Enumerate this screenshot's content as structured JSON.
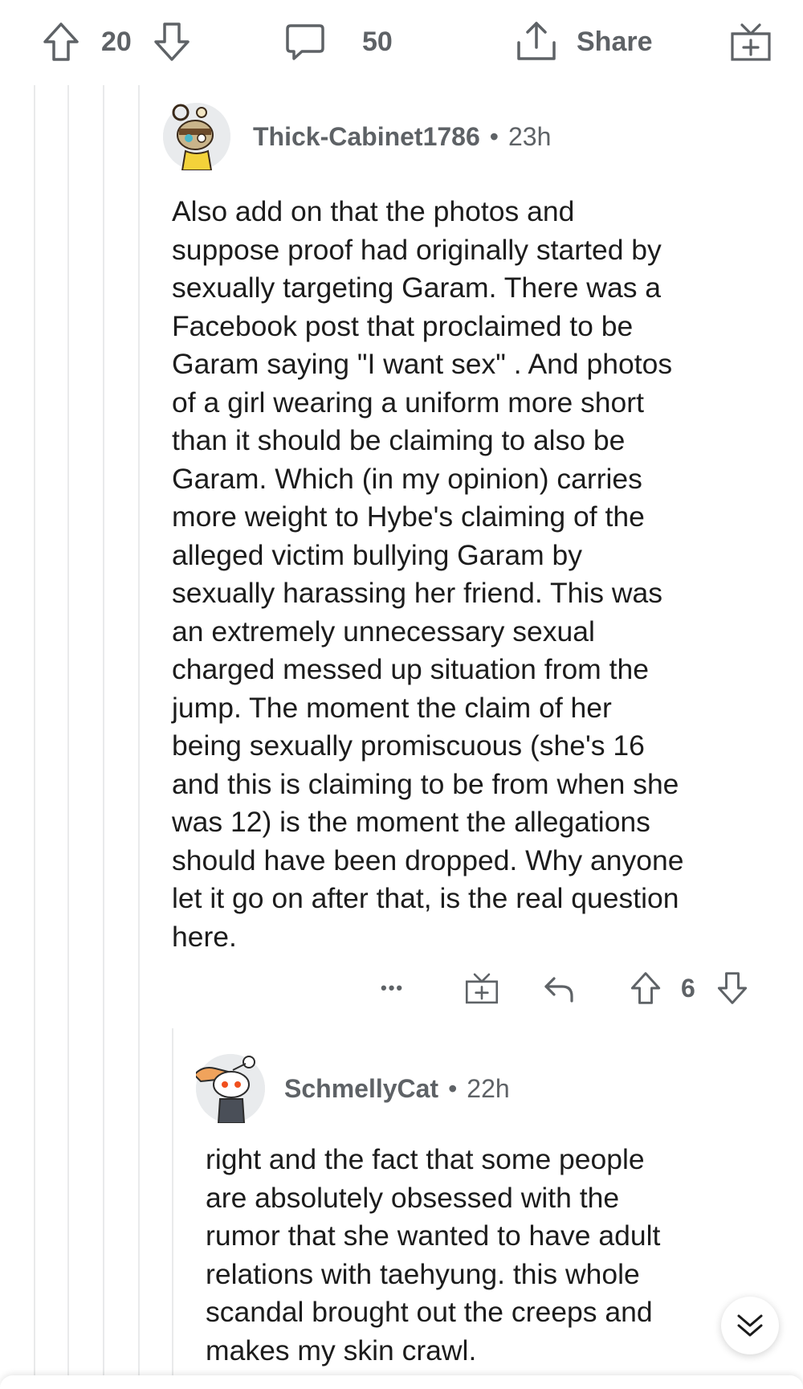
{
  "post_actions": {
    "upvote_icon": "upvote-arrow-icon",
    "score": "20",
    "downvote_icon": "downvote-arrow-icon",
    "comments_icon": "comment-bubble-icon",
    "comments_count": "50",
    "share_icon": "share-arrow-icon",
    "share_label": "Share",
    "award_icon": "gift-award-icon"
  },
  "comments": [
    {
      "author": "Thick-Cabinet1786",
      "separator": "•",
      "age": "23h",
      "lines": [
        "Also add on that the photos and",
        "suppose proof had originally started by",
        "sexually targeting Garam. There was a",
        "Facebook post that proclaimed to be",
        "Garam saying \"I want sex\" . And photos",
        "of a girl wearing a uniform more short",
        "than it should be claiming to also be",
        "Garam. Which (in my opinion) carries",
        "more weight to Hybe's claiming of the",
        "alleged victim bullying Garam by",
        "sexually harassing her friend. This was",
        "an extremely unnecessary sexual",
        "charged messed up situation from the",
        "jump. The moment the claim of her",
        "being sexually promiscuous (she's 16",
        "and this is claiming to be from when she",
        "was 12) is the moment the allegations",
        "should have been dropped. Why anyone",
        "let it go on after that, is the real question",
        "here."
      ],
      "actions": {
        "more_label": "•••",
        "award_icon": "gift-award-icon",
        "reply_icon": "reply-arrow-icon",
        "upvote_icon": "upvote-arrow-icon",
        "score": "6",
        "downvote_icon": "downvote-arrow-icon"
      }
    },
    {
      "author": "SchmellyCat",
      "separator": "•",
      "age": "22h",
      "lines": [
        "right and the fact that some people",
        "are absolutely obsessed with the",
        "rumor that she wanted to have adult",
        "relations with taehyung. this whole",
        "scandal brought out the creeps and",
        "makes my skin crawl."
      ]
    }
  ],
  "scroll_button_icon": "double-chevron-down-icon",
  "colors": {
    "text": "#1c1c1c",
    "muted": "#5e6266",
    "thread_line": "#e9eaeb",
    "background": "#ffffff"
  }
}
